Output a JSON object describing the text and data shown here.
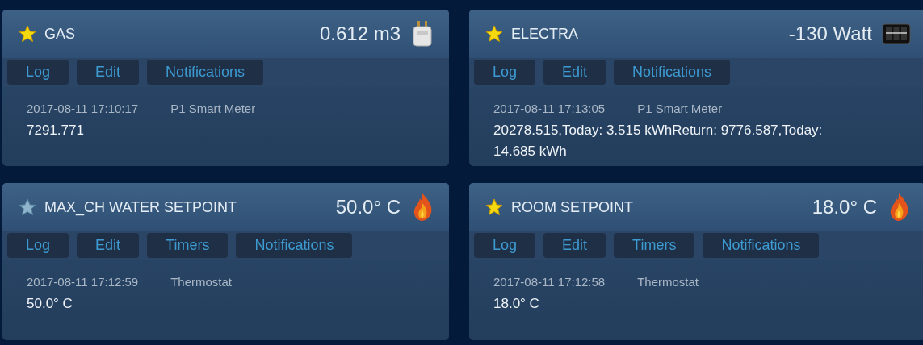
{
  "devices": [
    {
      "name": "GAS",
      "favorite": true,
      "value": "0.612 m3",
      "kind": "gas",
      "buttons": [
        "Log",
        "Edit",
        "Notifications"
      ],
      "last_update": "2017-08-11 17:10:17",
      "type": "P1 Smart Meter",
      "data": "7291.771"
    },
    {
      "name": "ELECTRA",
      "favorite": true,
      "value": "-130 Watt",
      "kind": "counter",
      "buttons": [
        "Log",
        "Edit",
        "Notifications"
      ],
      "last_update": "2017-08-11 17:13:05",
      "type": "P1 Smart Meter",
      "data": "20278.515,Today: 3.515 kWhReturn: 9776.587,Today: 14.685 kWh"
    },
    {
      "name": "MAX_CH WATER SETPOINT",
      "favorite": false,
      "value": "50.0° C",
      "kind": "flame",
      "buttons": [
        "Log",
        "Edit",
        "Timers",
        "Notifications"
      ],
      "last_update": "2017-08-11 17:12:59",
      "type": "Thermostat",
      "data": "50.0° C"
    },
    {
      "name": "ROOM SETPOINT",
      "favorite": true,
      "value": "18.0° C",
      "kind": "flame",
      "buttons": [
        "Log",
        "Edit",
        "Timers",
        "Notifications"
      ],
      "last_update": "2017-08-11 17:12:58",
      "type": "Thermostat",
      "data": "18.0° C"
    }
  ]
}
